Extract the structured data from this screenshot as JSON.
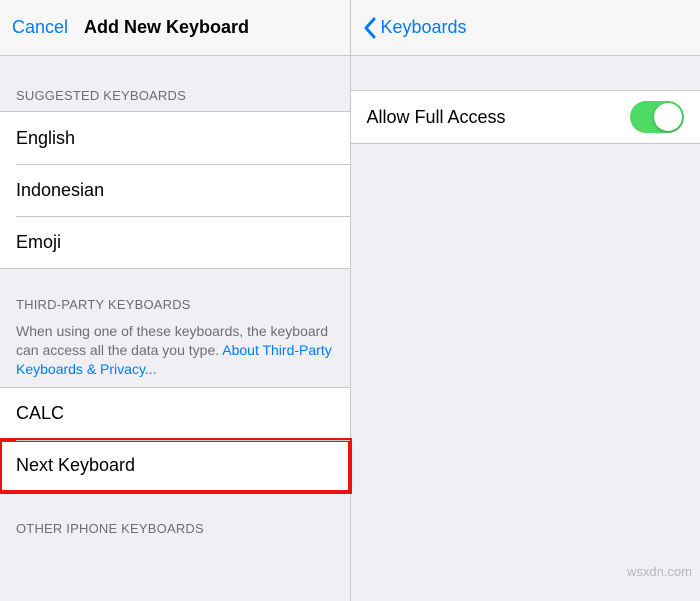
{
  "colors": {
    "accent": "#007aff",
    "toggleOn": "#4cd964",
    "highlight": "#e11"
  },
  "left": {
    "nav": {
      "cancel": "Cancel",
      "title": "Add New Keyboard"
    },
    "suggested": {
      "header": "SUGGESTED KEYBOARDS",
      "items": [
        "English",
        "Indonesian",
        "Emoji"
      ]
    },
    "thirdParty": {
      "header": "THIRD-PARTY KEYBOARDS",
      "desc1": "When using one of these keyboards, the keyboard can access all the data you type. ",
      "link": "About Third-Party Keyboards & Privacy...",
      "items": [
        "CALC",
        "Next Keyboard"
      ],
      "highlightIndex": 1
    },
    "other": {
      "header": "OTHER IPHONE KEYBOARDS"
    }
  },
  "right": {
    "nav": {
      "back": "Keyboards"
    },
    "allowFullAccess": {
      "label": "Allow Full Access",
      "value": true
    }
  },
  "watermark": "wsxdn.com"
}
